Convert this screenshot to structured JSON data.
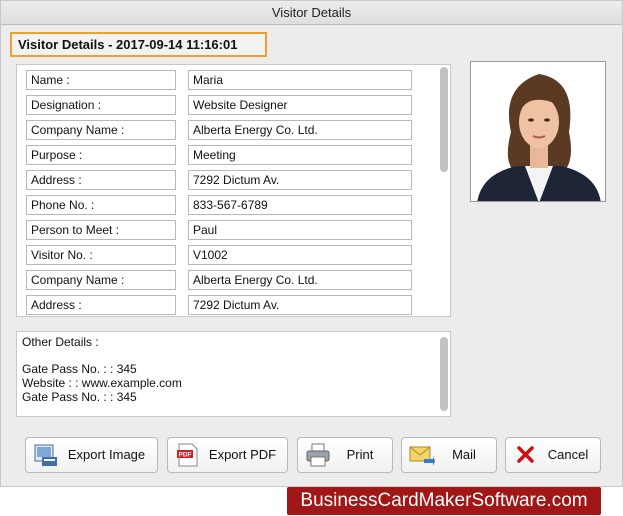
{
  "window": {
    "title": "Visitor Details"
  },
  "header": {
    "text": "Visitor Details - 2017-09-14 11:16:01"
  },
  "fields": [
    {
      "label": "Name :",
      "value": "Maria"
    },
    {
      "label": "Designation :",
      "value": "Website Designer"
    },
    {
      "label": "Company Name :",
      "value": "Alberta Energy Co. Ltd."
    },
    {
      "label": "Purpose :",
      "value": "Meeting"
    },
    {
      "label": "Address :",
      "value": "7292 Dictum Av."
    },
    {
      "label": "Phone No. :",
      "value": "833-567-6789"
    },
    {
      "label": "Person to Meet :",
      "value": "Paul"
    },
    {
      "label": "Visitor No. :",
      "value": "V1002"
    },
    {
      "label": "Company Name :",
      "value": "Alberta Energy Co. Ltd."
    },
    {
      "label": "Address :",
      "value": "7292 Dictum Av."
    }
  ],
  "other": {
    "title": "Other Details :",
    "lines": [
      "Gate Pass No. : : 345",
      "Website : : www.example.com",
      "Gate Pass No. : : 345"
    ]
  },
  "buttons": {
    "export_image": "Export Image",
    "export_pdf": "Export PDF",
    "print": "Print",
    "mail": "Mail",
    "cancel": "Cancel"
  },
  "icons": {
    "export_image": "image-export-icon",
    "export_pdf": "pdf-icon",
    "print": "printer-icon",
    "mail": "mail-icon",
    "cancel": "close-icon"
  },
  "brand": {
    "text": "BusinessCardMakerSoftware.com"
  },
  "colors": {
    "header_border": "#f0a030",
    "brand_bg": "#a11616",
    "cancel_x": "#d01010"
  }
}
